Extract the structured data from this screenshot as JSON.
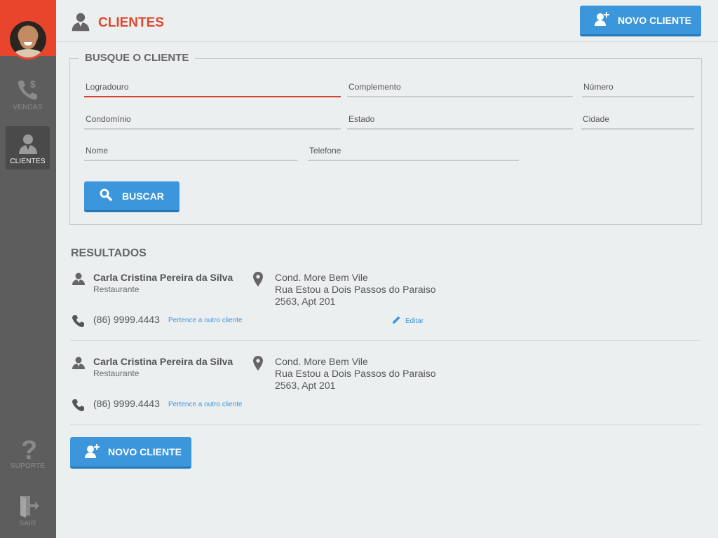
{
  "sidebar": {
    "items": [
      {
        "label": "VENDAS",
        "icon": "phone-dollar-icon"
      },
      {
        "label": "CLIENTES",
        "icon": "person-icon",
        "active": true
      },
      {
        "label": "SUPORTE",
        "icon": "question-icon"
      },
      {
        "label": "SAIR",
        "icon": "exit-door-icon"
      }
    ]
  },
  "header": {
    "title": "CLIENTES",
    "new_client_label": "NOVO CLIENTE"
  },
  "search": {
    "legend": "BUSQUE O CLIENTE",
    "fields": {
      "logradouro": "Logradouro",
      "complemento": "Complemento",
      "numero": "Número",
      "condominio": "Condomínio",
      "estado": "Estado",
      "cidade": "Cidade",
      "nome": "Nome",
      "telefone": "Telefone"
    },
    "button_label": "BUSCAR"
  },
  "results": {
    "title": "RESULTADOS",
    "items": [
      {
        "name": "Carla Cristina Pereira da Silva",
        "type": "Restaurante",
        "address_line1": "Cond. More Bem Vile",
        "address_line2": "Rua Estou a Dois Passos do Paraiso",
        "address_line3": "2563, Apt 201",
        "phone": "(86) 9999.4443",
        "link": "Pertence a outro cliente",
        "edit": "Editar"
      },
      {
        "name": "Carla Cristina Pereira da Silva",
        "type": "Restaurante",
        "address_line1": "Cond. More Bem Vile",
        "address_line2": "Rua Estou a Dois Passos do Paraiso",
        "address_line3": "2563, Apt 201",
        "phone": "(86) 9999.4443",
        "link": "Pertence a outro cliente"
      }
    ]
  },
  "footer": {
    "new_client_label": "NOVO CLIENTE"
  },
  "colors": {
    "accent": "#e0472f",
    "primary_button": "#3c96db",
    "sidebar": "#5d5d5d"
  }
}
